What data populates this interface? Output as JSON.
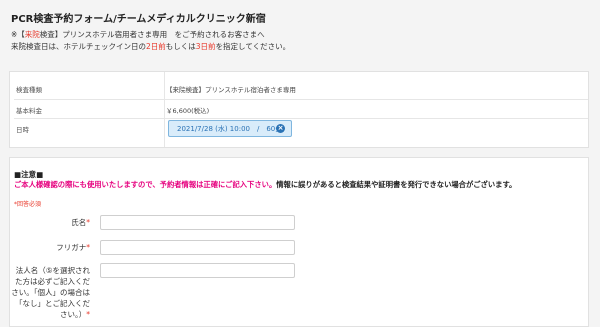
{
  "header": {
    "title": "PCR検査予約フォーム/チームメディカルクリニック新宿",
    "notice1_prefix": "※【",
    "notice1_red": "来院",
    "notice1_suffix": "検査】プリンスホテル宿用者さま専用　をご予約されるお客さまへ",
    "notice2_prefix": "来院検査日は、ホテルチェックイン日の",
    "notice2_red1": "2日前",
    "notice2_mid": "もしくは",
    "notice2_red2": "3日前",
    "notice2_suffix": "を指定してください。"
  },
  "summary": {
    "rows": [
      {
        "label": "検査種類",
        "value": "【来院検査】プリンスホテル宿泊者さま専用"
      },
      {
        "label": "基本料金",
        "value": "￥6,600(税込)"
      },
      {
        "label": "日時",
        "value": ""
      }
    ],
    "date_pill_text": "2021/7/28 (水) 10:00　/　60分",
    "date_pill_close": "×"
  },
  "form": {
    "section_head": "■注意■",
    "warn_pink": "ご本人様確認の際にも使用いたしますので、予約者情報は正確にご記入下さい。",
    "warn_dark": "情報に誤りがあると検査結果や証明書を発行できない場合がございます。",
    "required_note": "*回答必須",
    "fields": [
      {
        "label": "氏名",
        "required_mark": "*",
        "value": ""
      },
      {
        "label": "フリガナ",
        "required_mark": "*",
        "value": ""
      },
      {
        "label": "法人名（⑤を選択された方は必ずご記入ください。「個人」の場合は「なし」とご記入ください。）",
        "required_mark": "*",
        "value": ""
      }
    ]
  }
}
